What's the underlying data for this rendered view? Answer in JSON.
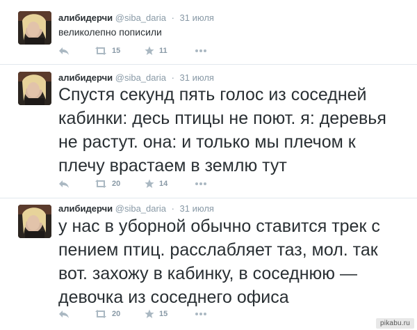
{
  "tweets": [
    {
      "fullname": "алибидерчи",
      "username": "@siba_daria",
      "separator": "·",
      "time": "31 июля",
      "text": "великолепно пописили",
      "retweets": "15",
      "favorites": "11"
    },
    {
      "fullname": "алибидерчи",
      "username": "@siba_daria",
      "separator": "·",
      "time": "31 июля",
      "lines": [
        "Спустя секунд пять голос из соседней",
        "кабинки: десь птицы не поют. я: деревья",
        "не растут. она: и только мы плечом к",
        "плечу врастаем в землю тут"
      ],
      "retweets": "20",
      "favorites": "14"
    },
    {
      "fullname": "алибидерчи",
      "username": "@siba_daria",
      "separator": "·",
      "time": "31 июля",
      "lines": [
        "у нас в уборной обычно ставится трек с",
        "пением птиц. расслабляет таз, мол. так",
        "вот. захожу в кабинку, в соседнюю —",
        "девочка из соседнего офиса"
      ],
      "retweets": "20",
      "favorites": "15"
    }
  ],
  "icons": {
    "reply": "reply-icon",
    "retweet": "retweet-icon",
    "favorite": "star-icon",
    "more": "more-icon"
  },
  "colors": {
    "text": "#292f33",
    "muted": "#8899a6",
    "icon": "#aab8c2",
    "divider": "#e1e8ed"
  },
  "watermark": "pikabu.ru"
}
